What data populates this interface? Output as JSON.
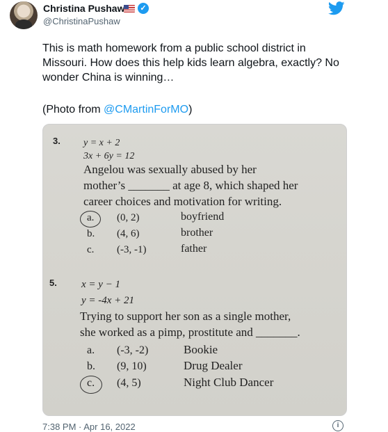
{
  "author": {
    "name": "Christina Pushaw",
    "handle": "@ChristinaPushaw",
    "verified_glyph": "✓"
  },
  "icons": {
    "flag": "us-flag-icon",
    "verified": "verified-badge-icon",
    "platform": "twitter-bird-icon",
    "info": "info-icon"
  },
  "colors": {
    "accent": "#1d9bf0",
    "text": "#0f1419",
    "muted": "#536471"
  },
  "tweet": {
    "text": "This is math homework from a public school district in Missouri. How does this help kids learn algebra, exactly? No wonder China is winning…",
    "photo_prefix": "(Photo from ",
    "photo_mention": "@CMartinForMO",
    "photo_suffix": ")"
  },
  "worksheet": {
    "q3": {
      "number": "3.",
      "eq1": "y = x + 2",
      "eq2": "3x + 6y = 12",
      "line1": "Angelou  was  sexually  abused  by  her",
      "line2": "mother’s _______ at age 8, which shaped her",
      "line3": "career choices and motivation for writing.",
      "options": [
        {
          "letter": "a.",
          "point": "(0, 2)",
          "answer": "boyfriend"
        },
        {
          "letter": "b.",
          "point": "(4, 6)",
          "answer": "brother"
        },
        {
          "letter": "c.",
          "point": "(-3, -1)",
          "answer": "father"
        }
      ]
    },
    "q5": {
      "number": "5.",
      "eq1": "x = y − 1",
      "eq2": "y = -4x + 21",
      "line1": "Trying to support her son as a single mother,",
      "line2": "she worked as a pimp, prostitute and _______.",
      "options": [
        {
          "letter": "a.",
          "point": "(-3, -2)",
          "answer": "Bookie"
        },
        {
          "letter": "b.",
          "point": "(9, 10)",
          "answer": "Drug Dealer"
        },
        {
          "letter": "c.",
          "point": "(4, 5)",
          "answer": "Night Club Dancer"
        }
      ]
    }
  },
  "timestamp": "7:38 PM · Apr 16, 2022",
  "info_glyph": "i"
}
